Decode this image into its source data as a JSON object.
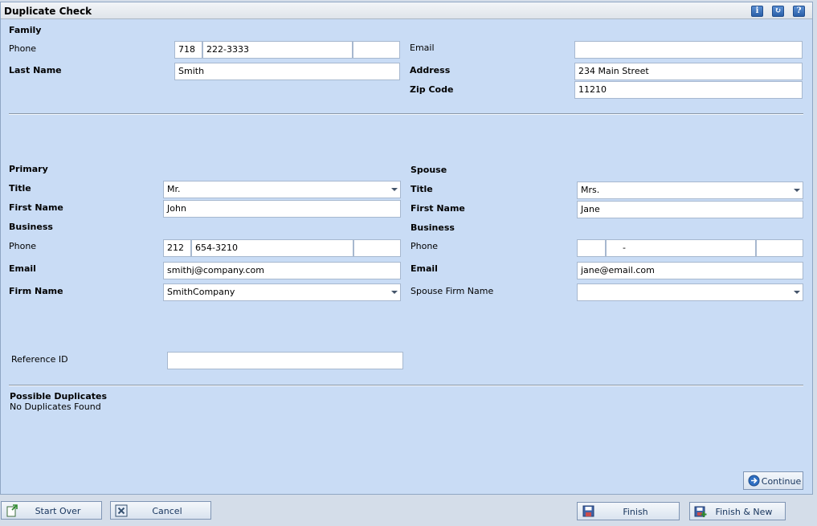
{
  "window": {
    "title": "Duplicate Check"
  },
  "titlebar_icons": [
    "info-icon",
    "refresh-icon",
    "help-icon"
  ],
  "family": {
    "section": "Family",
    "phone_label": "Phone",
    "phone_area": "718",
    "phone_number": "222-3333",
    "phone_ext": "",
    "last_name_label": "Last Name",
    "last_name": "Smith",
    "email_label": "Email",
    "email": "",
    "address_label": "Address",
    "address": "234 Main Street",
    "zip_label": "Zip Code",
    "zip": "11210"
  },
  "primary": {
    "section": "Primary",
    "title_label": "Title",
    "title": "Mr.",
    "first_name_label": "First Name",
    "first_name": "John",
    "business_label": "Business",
    "phone_label": "Phone",
    "phone_area": "212",
    "phone_number": "654-3210",
    "phone_ext": "",
    "email_label": "Email",
    "email": "smithj@company.com",
    "firm_label": "Firm Name",
    "firm": "SmithCompany"
  },
  "spouse": {
    "section": "Spouse",
    "title_label": "Title",
    "title": "Mrs.",
    "first_name_label": "First Name",
    "first_name": "Jane",
    "business_label": "Business",
    "phone_label": "Phone",
    "phone_area": "",
    "phone_number": "-",
    "phone_ext": "",
    "email_label": "Email",
    "email": "jane@email.com",
    "firm_label": "Spouse Firm Name",
    "firm": ""
  },
  "reference": {
    "label": "Reference ID",
    "value": ""
  },
  "duplicates": {
    "heading": "Possible Duplicates",
    "status": "No Duplicates Found"
  },
  "buttons": {
    "continue": "Continue",
    "start_over": "Start Over",
    "cancel": "Cancel",
    "finish": "Finish",
    "finish_new": "Finish & New"
  },
  "colors": {
    "panel": "#c9dcf5",
    "field_border": "#a7b8cf",
    "button_text": "#16335c"
  }
}
